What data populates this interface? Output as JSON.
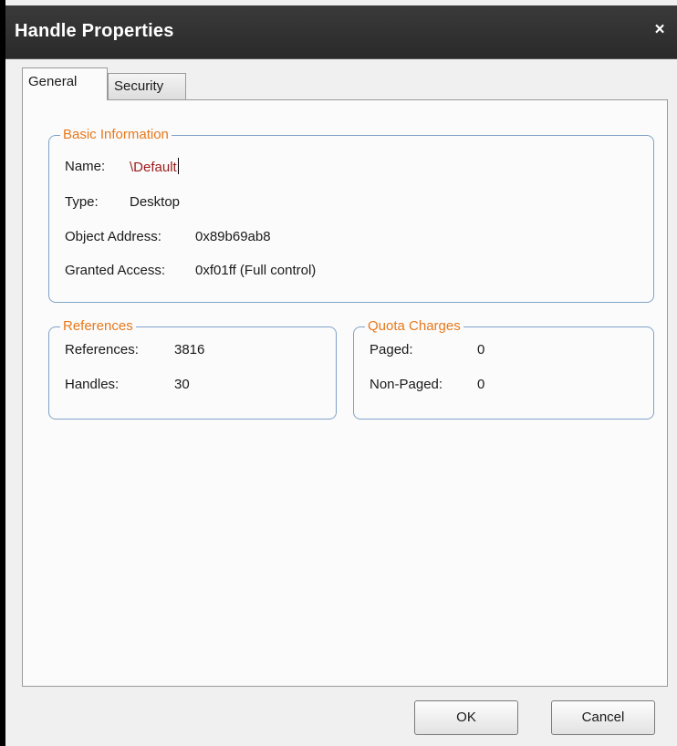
{
  "window": {
    "title": "Handle Properties",
    "close_glyph": "×"
  },
  "tabs": [
    {
      "label": "General",
      "active": true
    },
    {
      "label": "Security",
      "active": false
    }
  ],
  "basic_info": {
    "legend": "Basic Information",
    "name_label": "Name:",
    "name_value": "\\Default",
    "type_label": "Type:",
    "type_value": "Desktop",
    "address_label": "Object Address:",
    "address_value": "0x89b69ab8",
    "access_label": "Granted Access:",
    "access_value": "0xf01ff (Full control)"
  },
  "references": {
    "legend": "References",
    "references_label": "References:",
    "references_value": "3816",
    "handles_label": "Handles:",
    "handles_value": "30"
  },
  "quota": {
    "legend": "Quota Charges",
    "paged_label": "Paged:",
    "paged_value": "0",
    "nonpaged_label": "Non-Paged:",
    "nonpaged_value": "0"
  },
  "buttons": {
    "ok": "OK",
    "cancel": "Cancel"
  },
  "colors": {
    "legend": "#e8791c",
    "group_border": "#7fa2c8",
    "name_value": "#9b1b1b",
    "titlebar": "#2e2e2e"
  },
  "icons": {
    "close": "close-icon"
  }
}
